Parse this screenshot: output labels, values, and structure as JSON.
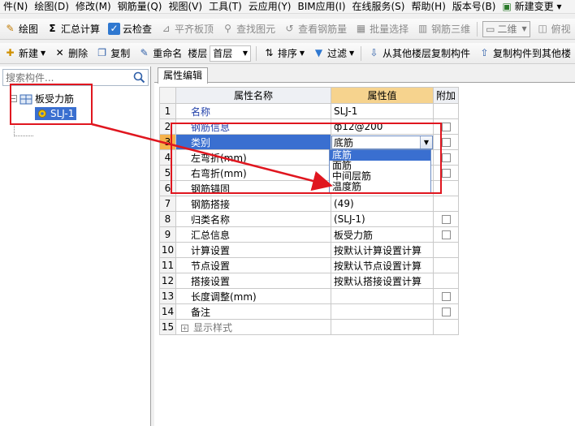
{
  "menubar": {
    "items": [
      "件(N)",
      "绘图(D)",
      "修改(M)",
      "钢筋量(Q)",
      "视图(V)",
      "工具(T)",
      "云应用(Y)",
      "BIM应用(I)",
      "在线服务(S)",
      "帮助(H)",
      "版本号(B)",
      "新建变更"
    ]
  },
  "toolbar1": {
    "draw": "绘图",
    "sum": "汇总计算",
    "cloudcheck": "云检查",
    "flattop": "平齐板顶",
    "findelem": "查找图元",
    "viewrebar": "查看钢筋量",
    "batchselect": "批量选择",
    "rebar3d": "钢筋三维",
    "view_mode": "二维",
    "overhead": "俯视"
  },
  "toolbar2": {
    "new": "新建",
    "delete": "删除",
    "copy": "复制",
    "rename": "重命名",
    "floor_label": "楼层",
    "floor_value": "首层",
    "sort": "排序",
    "filter": "过滤",
    "copy_from_floor": "从其他楼层复制构件",
    "copy_to_floor": "复制构件到其他楼"
  },
  "left": {
    "search_placeholder": "搜索构件...",
    "tree_root": "板受力筋",
    "tree_child": "SLJ-1"
  },
  "right": {
    "tab": "属性编辑",
    "headers": {
      "name": "属性名称",
      "value": "属性值",
      "extra": "附加"
    },
    "rows": [
      {
        "num": "1",
        "name": "名称",
        "value": "SLJ-1"
      },
      {
        "num": "2",
        "name": "钢筋信息",
        "value": "ф12@200"
      },
      {
        "num": "3",
        "name": "类别",
        "value": "底筋"
      },
      {
        "num": "4",
        "name": "左弯折(mm)",
        "value": ""
      },
      {
        "num": "5",
        "name": "右弯折(mm)",
        "value": ""
      },
      {
        "num": "6",
        "name": "钢筋锚固",
        "value": ""
      },
      {
        "num": "7",
        "name": "钢筋搭接",
        "value": "(49)"
      },
      {
        "num": "8",
        "name": "归类名称",
        "value": "(SLJ-1)"
      },
      {
        "num": "9",
        "name": "汇总信息",
        "value": "板受力筋"
      },
      {
        "num": "10",
        "name": "计算设置",
        "value": "按默认计算设置计算"
      },
      {
        "num": "11",
        "name": "节点设置",
        "value": "按默认节点设置计算"
      },
      {
        "num": "12",
        "name": "搭接设置",
        "value": "按默认搭接设置计算"
      },
      {
        "num": "13",
        "name": "长度调整(mm)",
        "value": ""
      },
      {
        "num": "14",
        "name": "备注",
        "value": ""
      },
      {
        "num": "15",
        "name": "显示样式",
        "value": ""
      }
    ],
    "dropdown_options": [
      "底筋",
      "面筋",
      "中间层筋",
      "温度筋"
    ]
  },
  "colors": {
    "accent": "#3a6fd0",
    "value_header": "#f6d38e",
    "annotation": "#e0161f"
  }
}
